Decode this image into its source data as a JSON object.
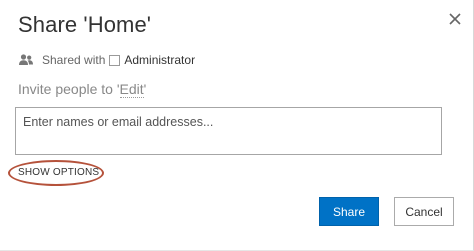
{
  "dialog": {
    "title": "Share 'Home'",
    "close_icon": "close-icon"
  },
  "shared_with": {
    "icon": "people-icon",
    "label": "Shared with",
    "users": [
      "Administrator"
    ]
  },
  "invite": {
    "prefix": "Invite people to '",
    "permission": "Edit",
    "suffix": "'"
  },
  "names_input": {
    "placeholder": "Enter names or email addresses...",
    "value": ""
  },
  "show_options": {
    "label": "SHOW OPTIONS",
    "highlight_color": "#b5523b"
  },
  "buttons": {
    "share": "Share",
    "cancel": "Cancel"
  },
  "colors": {
    "primary": "#0072c6",
    "text": "#333333",
    "muted": "#888888"
  }
}
